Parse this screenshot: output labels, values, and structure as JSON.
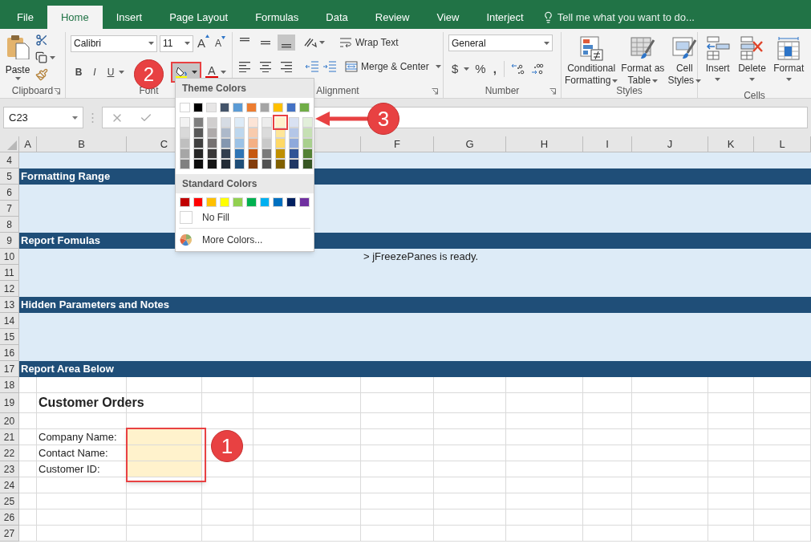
{
  "tabs": [
    {
      "label": "File",
      "selected": false
    },
    {
      "label": "Home",
      "selected": true
    },
    {
      "label": "Insert",
      "selected": false
    },
    {
      "label": "Page Layout",
      "selected": false
    },
    {
      "label": "Formulas",
      "selected": false
    },
    {
      "label": "Data",
      "selected": false
    },
    {
      "label": "Review",
      "selected": false
    },
    {
      "label": "View",
      "selected": false
    },
    {
      "label": "Interject",
      "selected": false
    }
  ],
  "tell_me": {
    "placeholder": "Tell me what you want to do..."
  },
  "ribbon": {
    "clipboard": {
      "paste": "Paste",
      "label": "Clipboard"
    },
    "font": {
      "name": "Calibri",
      "size": "11",
      "grow": "A",
      "shrink": "A",
      "bold": "B",
      "italic": "I",
      "underline": "U",
      "font_color": "A",
      "label": "Font"
    },
    "alignment": {
      "valign": [
        {
          "selected": false
        },
        {
          "selected": false
        },
        {
          "selected": true
        }
      ],
      "wrap": "Wrap Text",
      "merge": "Merge & Center",
      "label": "Alignment"
    },
    "number": {
      "format": "General",
      "currency": "$",
      "percent": "%",
      "comma": ",",
      "label": "Number"
    },
    "styles": {
      "buttons": [
        {
          "kind": "conditional",
          "lines": [
            "Conditional",
            "Formatting"
          ]
        },
        {
          "kind": "table",
          "lines": [
            "Format as",
            "Table"
          ]
        },
        {
          "kind": "cellstyles",
          "lines": [
            "Cell",
            "Styles"
          ]
        }
      ],
      "label": "Styles"
    },
    "cells": {
      "buttons": [
        {
          "kind": "insert",
          "label": "Insert"
        },
        {
          "kind": "delete",
          "label": "Delete"
        },
        {
          "kind": "format",
          "label": "Format"
        }
      ],
      "label": "Cells"
    }
  },
  "name_box": "C23",
  "columns": [
    "A",
    "B",
    "C",
    "F",
    "G",
    "H",
    "I",
    "J",
    "K",
    "L"
  ],
  "rows": [
    {
      "number": "4",
      "kind": "band"
    },
    {
      "number": "5",
      "kind": "section",
      "title": "Formatting Range"
    },
    {
      "number": "6",
      "kind": "band"
    },
    {
      "number": "7",
      "kind": "band"
    },
    {
      "number": "8",
      "kind": "band"
    },
    {
      "number": "9",
      "kind": "section",
      "title": "Report Fomulas"
    },
    {
      "number": "10",
      "kind": "band",
      "note": "> jFreezePanes is ready."
    },
    {
      "number": "11",
      "kind": "band"
    },
    {
      "number": "12",
      "kind": "band"
    },
    {
      "number": "13",
      "kind": "section",
      "title": "Hidden Parameters and Notes"
    },
    {
      "number": "14",
      "kind": "band"
    },
    {
      "number": "15",
      "kind": "band"
    },
    {
      "number": "16",
      "kind": "band"
    },
    {
      "number": "17",
      "kind": "section",
      "title": "Report Area Below"
    },
    {
      "number": "18",
      "kind": "cells"
    },
    {
      "number": "19",
      "kind": "title",
      "text": "Customer Orders"
    },
    {
      "number": "20",
      "kind": "cells"
    },
    {
      "number": "21",
      "kind": "field",
      "label": "Company Name:",
      "highlighted": true
    },
    {
      "number": "22",
      "kind": "field",
      "label": "Contact Name:",
      "highlighted": true
    },
    {
      "number": "23",
      "kind": "field",
      "label": "Customer ID:",
      "highlighted": true
    },
    {
      "number": "24",
      "kind": "cells"
    },
    {
      "number": "25",
      "kind": "cells"
    },
    {
      "number": "26",
      "kind": "cells"
    },
    {
      "number": "27",
      "kind": "cells"
    }
  ],
  "fill_menu": {
    "theme_title": "Theme Colors",
    "theme": [
      {
        "color": "#ffffff",
        "selected": false,
        "shades": [
          {
            "color": "#f2f2f2",
            "selected": false
          },
          {
            "color": "#d9d9d9",
            "selected": false
          },
          {
            "color": "#bfbfbf",
            "selected": false
          },
          {
            "color": "#a6a6a6",
            "selected": false
          },
          {
            "color": "#808080",
            "selected": false
          }
        ]
      },
      {
        "color": "#000000",
        "selected": false,
        "shades": [
          {
            "color": "#7f7f7f",
            "selected": false
          },
          {
            "color": "#595959",
            "selected": false
          },
          {
            "color": "#404040",
            "selected": false
          },
          {
            "color": "#262626",
            "selected": false
          },
          {
            "color": "#0d0d0d",
            "selected": false
          }
        ]
      },
      {
        "color": "#e7e6e6",
        "selected": false,
        "shades": [
          {
            "color": "#d0cece",
            "selected": false
          },
          {
            "color": "#aeaaaa",
            "selected": false
          },
          {
            "color": "#757171",
            "selected": false
          },
          {
            "color": "#3a3838",
            "selected": false
          },
          {
            "color": "#161616",
            "selected": false
          }
        ]
      },
      {
        "color": "#44546a",
        "selected": false,
        "shades": [
          {
            "color": "#d6dce4",
            "selected": false
          },
          {
            "color": "#adb9ca",
            "selected": false
          },
          {
            "color": "#8497b0",
            "selected": false
          },
          {
            "color": "#333f4f",
            "selected": false
          },
          {
            "color": "#222b35",
            "selected": false
          }
        ]
      },
      {
        "color": "#5b9bd5",
        "selected": false,
        "shades": [
          {
            "color": "#ddebf7",
            "selected": false
          },
          {
            "color": "#bdd7ee",
            "selected": false
          },
          {
            "color": "#9bc2e6",
            "selected": false
          },
          {
            "color": "#2f75b5",
            "selected": false
          },
          {
            "color": "#1f4e78",
            "selected": false
          }
        ]
      },
      {
        "color": "#ed7d31",
        "selected": false,
        "shades": [
          {
            "color": "#fce4d6",
            "selected": false
          },
          {
            "color": "#f8cbad",
            "selected": false
          },
          {
            "color": "#f4b084",
            "selected": false
          },
          {
            "color": "#c65911",
            "selected": false
          },
          {
            "color": "#833c0c",
            "selected": false
          }
        ]
      },
      {
        "color": "#a5a5a5",
        "selected": false,
        "shades": [
          {
            "color": "#ededed",
            "selected": false
          },
          {
            "color": "#dbdbdb",
            "selected": false
          },
          {
            "color": "#c9c9c9",
            "selected": false
          },
          {
            "color": "#7b7b7b",
            "selected": false
          },
          {
            "color": "#525252",
            "selected": false
          }
        ]
      },
      {
        "color": "#ffc000",
        "selected": false,
        "shades": [
          {
            "color": "#fff2cc",
            "selected": true
          },
          {
            "color": "#ffe699",
            "selected": false
          },
          {
            "color": "#ffd966",
            "selected": false
          },
          {
            "color": "#bf8f00",
            "selected": false
          },
          {
            "color": "#806000",
            "selected": false
          }
        ]
      },
      {
        "color": "#4472c4",
        "selected": false,
        "shades": [
          {
            "color": "#d9e1f2",
            "selected": false
          },
          {
            "color": "#b4c6e7",
            "selected": false
          },
          {
            "color": "#8ea9db",
            "selected": false
          },
          {
            "color": "#305496",
            "selected": false
          },
          {
            "color": "#203764",
            "selected": false
          }
        ]
      },
      {
        "color": "#70ad47",
        "selected": false,
        "shades": [
          {
            "color": "#e2efda",
            "selected": false
          },
          {
            "color": "#c6e0b4",
            "selected": false
          },
          {
            "color": "#a9d08e",
            "selected": false
          },
          {
            "color": "#548235",
            "selected": false
          },
          {
            "color": "#375623",
            "selected": false
          }
        ]
      }
    ],
    "standard_title": "Standard Colors",
    "standard": [
      {
        "color": "#c00000",
        "selected": false
      },
      {
        "color": "#ff0000",
        "selected": false
      },
      {
        "color": "#ffc000",
        "selected": false
      },
      {
        "color": "#ffff00",
        "selected": false
      },
      {
        "color": "#92d050",
        "selected": false
      },
      {
        "color": "#00b050",
        "selected": false
      },
      {
        "color": "#00b0f0",
        "selected": false
      },
      {
        "color": "#0070c0",
        "selected": false
      },
      {
        "color": "#002060",
        "selected": false
      },
      {
        "color": "#7030a0",
        "selected": false
      }
    ],
    "no_fill": "No Fill",
    "more": "More Colors..."
  },
  "callouts": [
    {
      "text": "2"
    },
    {
      "text": "3"
    },
    {
      "text": "1"
    }
  ]
}
